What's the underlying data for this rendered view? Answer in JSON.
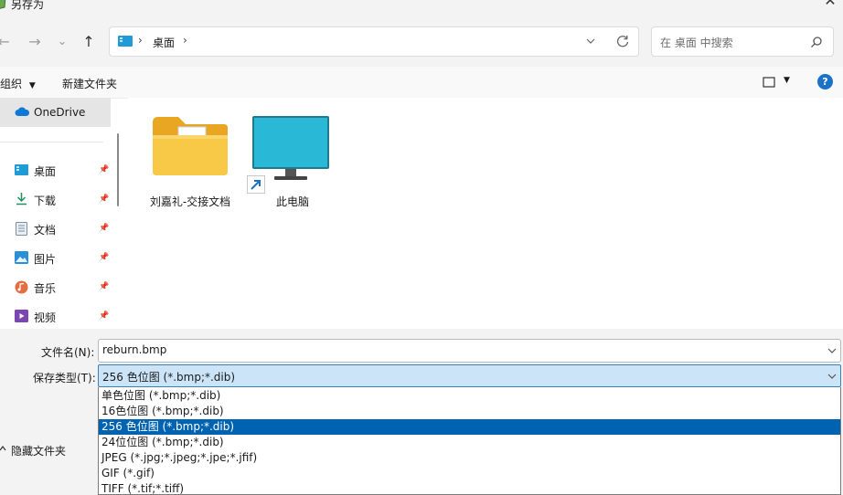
{
  "window": {
    "title": "另存为",
    "close_glyph": "✕"
  },
  "nav": {
    "back_glyph": "←",
    "forward_glyph": "→",
    "recent_glyph": "⌄",
    "up_glyph": "↑"
  },
  "address": {
    "path": [
      "桌面"
    ],
    "separator": "›"
  },
  "search": {
    "placeholder": "在 桌面 中搜索"
  },
  "toolbar": {
    "organize_label": "组织",
    "new_folder_label": "新建文件夹",
    "help_glyph": "?"
  },
  "sidebar": {
    "onedrive_label": "OneDrive",
    "items": [
      {
        "label": "桌面",
        "icon": "desktop-icon"
      },
      {
        "label": "下载",
        "icon": "download-icon"
      },
      {
        "label": "文档",
        "icon": "document-icon"
      },
      {
        "label": "图片",
        "icon": "pictures-icon"
      },
      {
        "label": "音乐",
        "icon": "music-icon"
      },
      {
        "label": "视频",
        "icon": "video-icon"
      }
    ]
  },
  "files": [
    {
      "name": "刘嘉礼-交接文档",
      "icon": "folder-with-word-doc-icon"
    },
    {
      "name": "此电脑",
      "icon": "monitor-shortcut-icon"
    }
  ],
  "form": {
    "filename_label": "文件名(N):",
    "filename_value": "reburn.bmp",
    "filetype_label": "保存类型(T):",
    "filetype_value": "256 色位图 (*.bmp;*.dib)",
    "filetype_options": [
      "单色位图 (*.bmp;*.dib)",
      "16色位图 (*.bmp;*.dib)",
      "256 色位图 (*.bmp;*.dib)",
      "24位位图 (*.bmp;*.dib)",
      "JPEG (*.jpg;*.jpeg;*.jpe;*.jfif)",
      "GIF (*.gif)",
      "TIFF (*.tif;*.tiff)"
    ],
    "selected_index": 2,
    "hide_folders_label": "隐藏文件夹"
  },
  "colors": {
    "selection": "#0063b1",
    "field_highlight": "#cce4f7",
    "help_circle": "#1a73c9",
    "onedrive_blue": "#0f78d4"
  }
}
